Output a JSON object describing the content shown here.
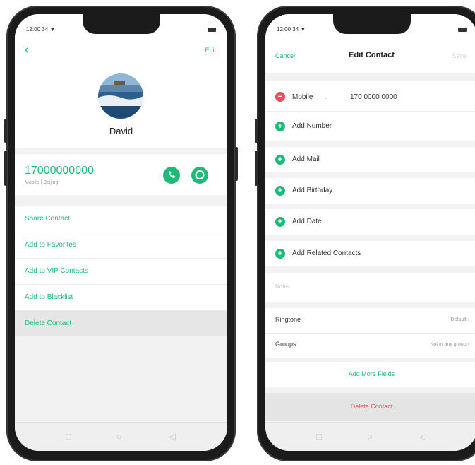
{
  "left_phone": {
    "status_time": "12:00 34 ▼",
    "edit_label": "Edit",
    "contact_name": "David",
    "phone_number": "17000000000",
    "number_subtitle": "Mobile | Beijing",
    "actions": [
      {
        "label": "Share Contact"
      },
      {
        "label": "Add to Favorites"
      },
      {
        "label": "Add to VIP Contacts"
      },
      {
        "label": "Add to Blacklist"
      },
      {
        "label": "Delete Contact"
      }
    ]
  },
  "right_phone": {
    "status_time": "12:00 34 ▼",
    "cancel_label": "Cancel",
    "title": "Edit Contact",
    "save_label": "Save",
    "mobile_label": "Mobile",
    "mobile_value": "170 0000 0000",
    "add_number": "Add Number",
    "add_mail": "Add Mail",
    "add_birthday": "Add Birthday",
    "add_date": "Add Date",
    "add_related": "Add Related Contacts",
    "notes_placeholder": "Notes",
    "ringtone_label": "Ringtone",
    "ringtone_value": "Default",
    "groups_label": "Groups",
    "groups_value": "Not in any group",
    "add_more_fields": "Add More Fields",
    "delete_contact": "Delete Contact"
  },
  "colors": {
    "accent": "#1fba7a",
    "danger": "#e8505b"
  }
}
